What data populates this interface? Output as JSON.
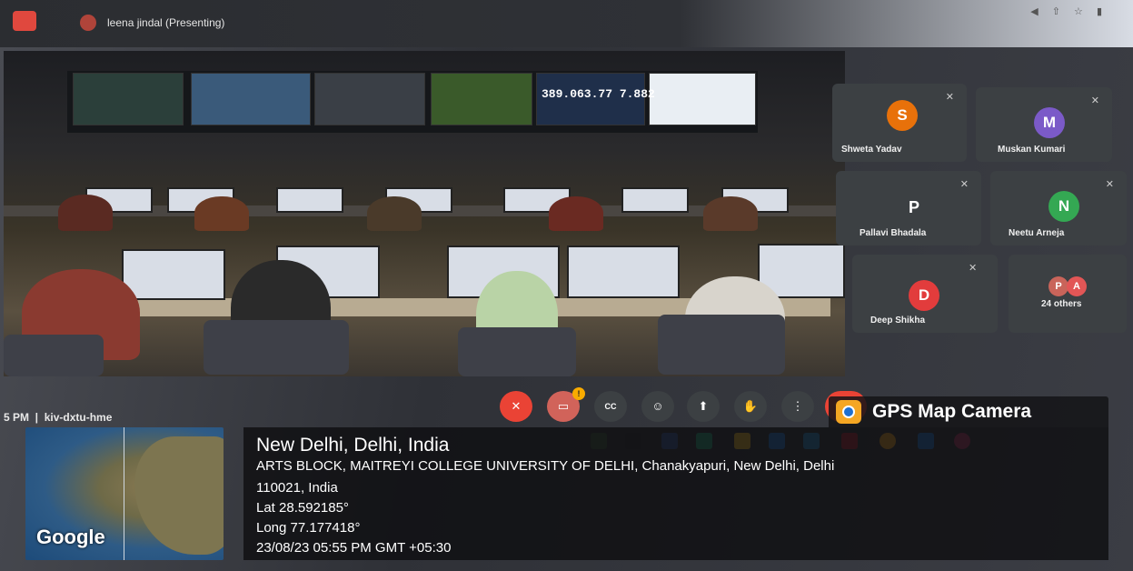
{
  "meet": {
    "presenter": "leena jindal (Presenting)",
    "meeting_code": "kiv-dxtu-hme",
    "time_fragment": "5 PM"
  },
  "stage_screen": {
    "readout": "389.063.77 7.882"
  },
  "participants": [
    {
      "name": "Shweta Yadav",
      "initial": "S",
      "color": "#e8710a"
    },
    {
      "name": "Muskan Kumari",
      "initial": "M",
      "color": "#7b5ac8"
    },
    {
      "name": "Pallavi Bhadala",
      "initial": "P",
      "color": "#3c4043"
    },
    {
      "name": "Neetu Arneja",
      "initial": "N",
      "color": "#34a853"
    },
    {
      "name": "Deep Shikha",
      "initial": "D",
      "color": "#e23c3c"
    }
  ],
  "others": {
    "label": "24 others",
    "avatars": [
      {
        "initial": "P",
        "color": "#c9645a"
      },
      {
        "initial": "A",
        "color": "#e25656"
      }
    ]
  },
  "controls": {
    "cc_label": "CC"
  },
  "gps": {
    "app_title": "GPS Map Camera",
    "map_brand": "Google",
    "city": "New Delhi, Delhi, India",
    "address_line1": "ARTS BLOCK, MAITREYI COLLEGE UNIVERSITY OF DELHI, Chanakyapuri, New Delhi, Delhi",
    "address_line2": "110021, India",
    "lat": "Lat 28.592185°",
    "long": "Long 77.177418°",
    "timestamp": "23/08/23 05:55 PM GMT +05:30"
  }
}
